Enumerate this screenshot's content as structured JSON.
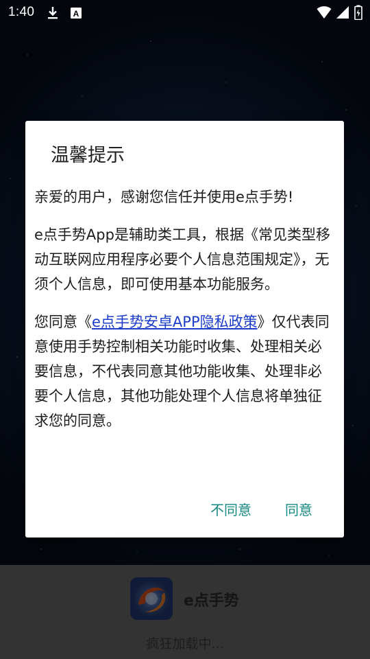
{
  "status_bar": {
    "time": "1:40",
    "icons": [
      "download-icon",
      "accessibility-icon",
      "wifi-icon",
      "signal-icon",
      "battery-icon"
    ]
  },
  "dialog": {
    "title": "温馨提示",
    "greeting": "亲爱的用户，感谢您信任并使用e点手势!",
    "paragraph2": "e点手势App是辅助类工具，根据《常见类型移动互联网应用程序必要个人信息范围规定》，无须个人信息，即可使用基本功能服务。",
    "paragraph3_prefix": "您同意《",
    "policy_link": "e点手势安卓APP隐私政策",
    "paragraph3_suffix": "》仅代表同意使用手势控制相关功能时收集、处理相关必要信息，不代表同意其他功能收集、处理非必要个人信息，其他功能处理个人信息将单独征求您的同意。",
    "disagree_label": "不同意",
    "agree_label": "同意"
  },
  "splash": {
    "app_name": "e点手势",
    "loading_text": "疯狂加载中..."
  },
  "colors": {
    "accent": "#168a82",
    "link": "#1a3cc8",
    "dialog_bg": "#ffffff",
    "bottom_bg": "#676767"
  }
}
